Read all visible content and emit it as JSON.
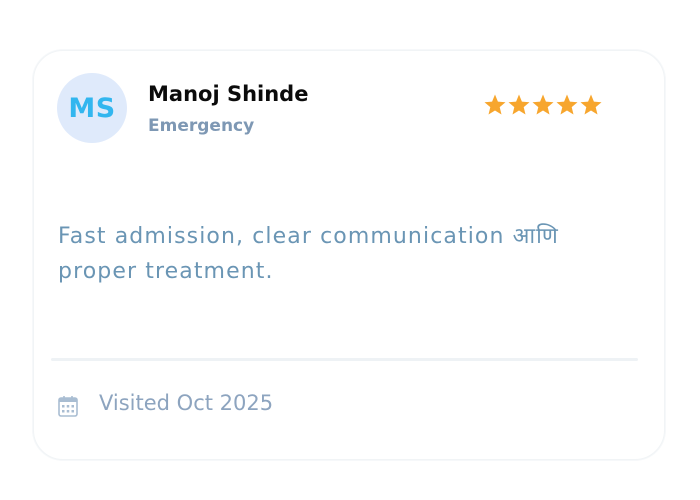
{
  "review": {
    "avatar_initials": "MS",
    "name": "Manoj Shinde",
    "department": "Emergency",
    "rating": 5,
    "rating_max": 5,
    "text": "Fast admission, clear communication आणि proper treatment.",
    "visited_label": "Visited Oct 2025"
  },
  "colors": {
    "avatar_bg": "#dfeafb",
    "avatar_text": "#32b6ef",
    "star": "#f7a62e",
    "review_text": "#6a95b4",
    "muted": "#7e98b4"
  },
  "icons": {
    "rating": "star-icon",
    "visit_date": "calendar-icon"
  }
}
